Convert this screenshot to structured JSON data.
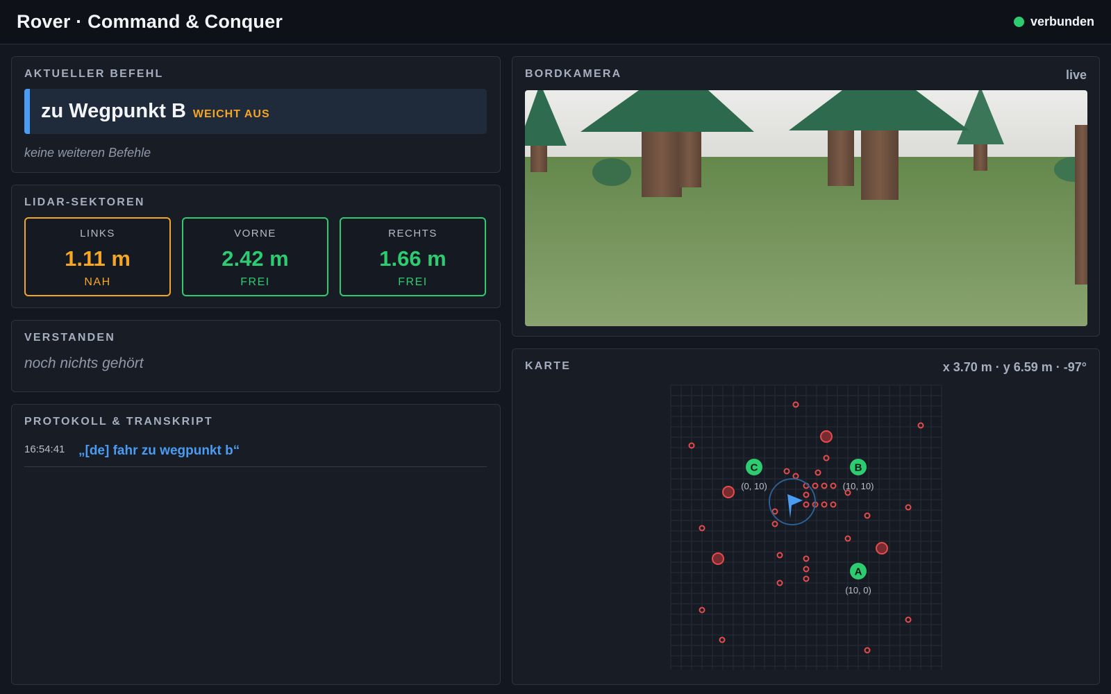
{
  "header": {
    "title": "Rover · Command & Conquer",
    "connection": "verbunden"
  },
  "command": {
    "title": "AKTUELLER BEFEHL",
    "current": "zu Wegpunkt B",
    "status": "WEICHT AUS",
    "queue_note": "keine weiteren Befehle"
  },
  "lidar": {
    "title": "LIDAR-SEKTOREN",
    "sectors": [
      {
        "label": "LINKS",
        "value": "1.11 m",
        "state": "NAH"
      },
      {
        "label": "VORNE",
        "value": "2.42 m",
        "state": "FREI"
      },
      {
        "label": "RECHTS",
        "value": "1.66 m",
        "state": "FREI"
      }
    ]
  },
  "understood": {
    "title": "VERSTANDEN",
    "text": "noch nichts gehört"
  },
  "log": {
    "title": "PROTOKOLL & TRANSKRIPT",
    "entries": [
      {
        "time": "16:54:41",
        "text": "„[de] fahr zu wegpunkt b“"
      }
    ]
  },
  "camera": {
    "title": "BORDKAMERA",
    "status": "live"
  },
  "map": {
    "title": "KARTE",
    "pose": "x 3.70 m · y 6.59 m · -97°",
    "waypoints": [
      {
        "id": "C",
        "coord": "(0, 10)"
      },
      {
        "id": "B",
        "coord": "(10, 10)"
      },
      {
        "id": "A",
        "coord": "(10, 0)"
      }
    ]
  },
  "colors": {
    "background": "#131720",
    "panel": "#181c25",
    "accent_blue": "#4a9bf2",
    "ok_green": "#2ecc71",
    "warn_orange": "#f5a623",
    "obstacle_red": "#e74c4c"
  },
  "icons": {
    "connection": "status-dot",
    "rover": "rover-heading-arrow",
    "obstacle": "obstacle-dot"
  }
}
